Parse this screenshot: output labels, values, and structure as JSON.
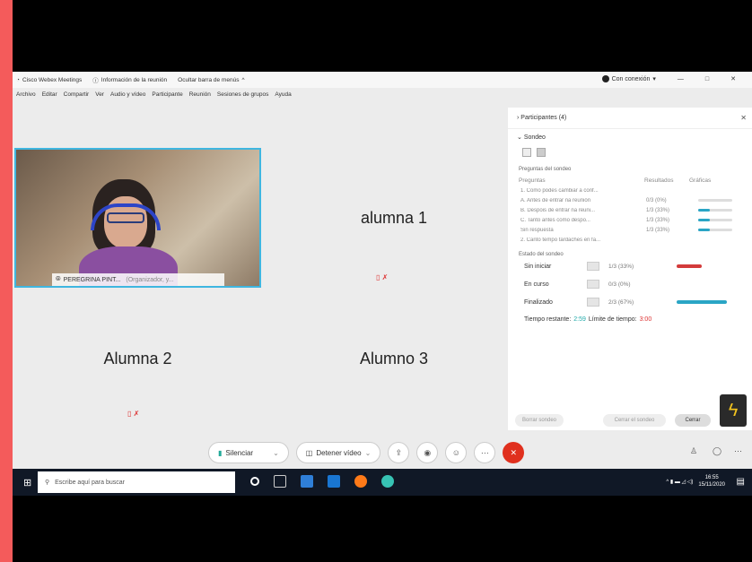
{
  "titlebar": {
    "app": "Cisco Webex Meetings",
    "meeting_info": "Información de la reunión",
    "hide_menu": "Ocultar barra de menús",
    "connected": "Con conexión",
    "window_controls": [
      "—",
      "□",
      "✕"
    ]
  },
  "menu": [
    "Archivo",
    "Editar",
    "Compartir",
    "Ver",
    "Audio y vídeo",
    "Participante",
    "Reunión",
    "Sesiones de grupos",
    "Ayuda"
  ],
  "videos": {
    "main_name": "PEREGRINA PINT...",
    "main_role": "(Organizador, y...",
    "tiles": [
      "alumna 1",
      "Alumna 2",
      "Alumno 3"
    ]
  },
  "panel": {
    "participants": "Participantes (4)",
    "poll": "Sondeo",
    "section_questions": "Preguntas del sondeo",
    "col_questions": "Preguntas",
    "col_results": "Resultados",
    "col_chart": "Gráficas",
    "rows": [
      {
        "q": "1. Como podes cambiar a conf...",
        "r": "",
        "bar": null
      },
      {
        "q": "A. Antes de entrar na reunión",
        "r": "0/3 (0%)",
        "bar": 0
      },
      {
        "q": "B. Despois de entrar na reuni...",
        "r": "1/3 (33%)",
        "bar": 0.33
      },
      {
        "q": "C. Tanto antes como despo...",
        "r": "1/3 (33%)",
        "bar": 0.33
      },
      {
        "q": "Sin respuesta",
        "r": "1/3 (33%)",
        "bar": 0.33
      },
      {
        "q": "2. Canto tempo tardaches en fa...",
        "r": "",
        "bar": null
      }
    ],
    "section_state": "Estado del sondeo",
    "states": [
      {
        "label": "Sin iniciar",
        "value": "1/3 (33%)",
        "bar": 0.33,
        "color": "#d33b3b"
      },
      {
        "label": "En curso",
        "value": "0/3 (0%)",
        "bar": 0,
        "color": "#2aa5c5"
      },
      {
        "label": "Finalizado",
        "value": "2/3 (67%)",
        "bar": 0.67,
        "color": "#2aa5c5"
      }
    ],
    "time_left_label": "Tiempo restante:",
    "time_left": "2:59",
    "time_limit_label": "Límite de tiempo:",
    "time_limit": "3:00",
    "buttons": [
      "Borrar sondeo",
      "Cerrar el sondeo",
      "Cerrar"
    ]
  },
  "controls": {
    "mute": "Silenciar",
    "stop_video": "Detener vídeo"
  },
  "taskbar": {
    "search_placeholder": "Escribe aquí para buscar",
    "time": "16:55",
    "date": "15/11/2020"
  }
}
